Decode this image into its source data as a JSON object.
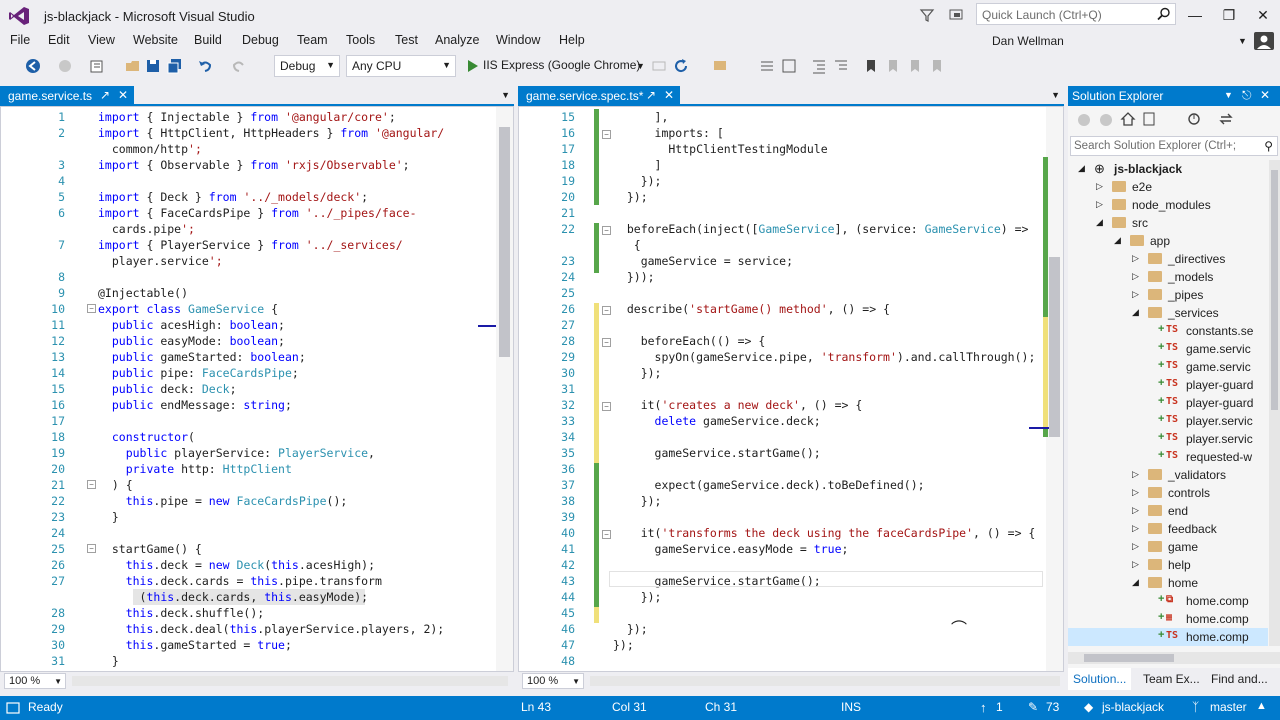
{
  "window": {
    "title": "js-blackjack - Microsoft Visual Studio",
    "quick_launch_placeholder": "Quick Launch (Ctrl+Q)"
  },
  "menu": [
    "File",
    "Edit",
    "View",
    "Website",
    "Build",
    "Debug",
    "Team",
    "Tools",
    "Test",
    "Analyze",
    "Window",
    "Help"
  ],
  "user": {
    "name": "Dan Wellman"
  },
  "toolbar": {
    "config": "Debug",
    "platform": "Any CPU",
    "run_target": "IIS Express (Google Chrome)"
  },
  "left_editor": {
    "tab": "game.service.ts",
    "zoom": "100 %",
    "lines": [
      {
        "n": "1",
        "code": "import { Injectable } from '@angular/core';"
      },
      {
        "n": "2",
        "code": "import { HttpClient, HttpHeaders } from '@angular/"
      },
      {
        "n": "",
        "code": "  common/http';"
      },
      {
        "n": "3",
        "code": "import { Observable } from 'rxjs/Observable';"
      },
      {
        "n": "4",
        "code": ""
      },
      {
        "n": "5",
        "code": "import { Deck } from '../_models/deck';"
      },
      {
        "n": "6",
        "code": "import { FaceCardsPipe } from '../_pipes/face-"
      },
      {
        "n": "",
        "code": "  cards.pipe';"
      },
      {
        "n": "7",
        "code": "import { PlayerService } from '../_services/"
      },
      {
        "n": "",
        "code": "  player.service';"
      },
      {
        "n": "8",
        "code": ""
      },
      {
        "n": "9",
        "code": "@Injectable()"
      },
      {
        "n": "10",
        "code": "export class GameService {"
      },
      {
        "n": "11",
        "code": "  public acesHigh: boolean;"
      },
      {
        "n": "12",
        "code": "  public easyMode: boolean;"
      },
      {
        "n": "13",
        "code": "  public gameStarted: boolean;"
      },
      {
        "n": "14",
        "code": "  public pipe: FaceCardsPipe;"
      },
      {
        "n": "15",
        "code": "  public deck: Deck;"
      },
      {
        "n": "16",
        "code": "  public endMessage: string;"
      },
      {
        "n": "17",
        "code": ""
      },
      {
        "n": "18",
        "code": "  constructor("
      },
      {
        "n": "19",
        "code": "    public playerService: PlayerService,"
      },
      {
        "n": "20",
        "code": "    private http: HttpClient"
      },
      {
        "n": "21",
        "code": "  ) {"
      },
      {
        "n": "22",
        "code": "    this.pipe = new FaceCardsPipe();"
      },
      {
        "n": "23",
        "code": "  }"
      },
      {
        "n": "24",
        "code": ""
      },
      {
        "n": "25",
        "code": "  startGame() {"
      },
      {
        "n": "26",
        "code": "    this.deck = new Deck(this.acesHigh);"
      },
      {
        "n": "27",
        "code": "    this.deck.cards = this.pipe.transform"
      },
      {
        "n": "",
        "code": "      (this.deck.cards, this.easyMode);"
      },
      {
        "n": "28",
        "code": "    this.deck.shuffle();"
      },
      {
        "n": "29",
        "code": "    this.deck.deal(this.playerService.players, 2);"
      },
      {
        "n": "30",
        "code": "    this.gameStarted = true;"
      },
      {
        "n": "31",
        "code": "  }"
      }
    ]
  },
  "right_editor": {
    "tab": "game.service.spec.ts*",
    "zoom": "100 %",
    "lines": [
      {
        "n": "15",
        "code": "      ],"
      },
      {
        "n": "16",
        "code": "      imports: ["
      },
      {
        "n": "17",
        "code": "        HttpClientTestingModule"
      },
      {
        "n": "18",
        "code": "      ]"
      },
      {
        "n": "19",
        "code": "    });"
      },
      {
        "n": "20",
        "code": "  });"
      },
      {
        "n": "21",
        "code": ""
      },
      {
        "n": "22",
        "code": "  beforeEach(inject([GameService], (service: GameService) =>"
      },
      {
        "n": "",
        "code": "   {"
      },
      {
        "n": "23",
        "code": "    gameService = service;"
      },
      {
        "n": "24",
        "code": "  }));"
      },
      {
        "n": "25",
        "code": ""
      },
      {
        "n": "26",
        "code": "  describe('startGame() method', () => {"
      },
      {
        "n": "27",
        "code": ""
      },
      {
        "n": "28",
        "code": "    beforeEach(() => {"
      },
      {
        "n": "29",
        "code": "      spyOn(gameService.pipe, 'transform').and.callThrough();"
      },
      {
        "n": "30",
        "code": "    });"
      },
      {
        "n": "31",
        "code": ""
      },
      {
        "n": "32",
        "code": "    it('creates a new deck', () => {"
      },
      {
        "n": "33",
        "code": "      delete gameService.deck;"
      },
      {
        "n": "34",
        "code": ""
      },
      {
        "n": "35",
        "code": "      gameService.startGame();"
      },
      {
        "n": "36",
        "code": ""
      },
      {
        "n": "37",
        "code": "      expect(gameService.deck).toBeDefined();"
      },
      {
        "n": "38",
        "code": "    });"
      },
      {
        "n": "39",
        "code": ""
      },
      {
        "n": "40",
        "code": "    it('transforms the deck using the faceCardsPipe', () => {"
      },
      {
        "n": "41",
        "code": "      gameService.easyMode = true;"
      },
      {
        "n": "42",
        "code": ""
      },
      {
        "n": "43",
        "code": "      gameService.startGame();"
      },
      {
        "n": "44",
        "code": "    });"
      },
      {
        "n": "45",
        "code": ""
      },
      {
        "n": "46",
        "code": "  });"
      },
      {
        "n": "47",
        "code": "});"
      },
      {
        "n": "48",
        "code": ""
      }
    ]
  },
  "solution_explorer": {
    "title": "Solution Explorer",
    "search_placeholder": "Search Solution Explorer (Ctrl+;",
    "items": [
      {
        "label": "js-blackjack",
        "depth": 0,
        "type": "solution",
        "arrow": "open"
      },
      {
        "label": "e2e",
        "depth": 1,
        "type": "folder",
        "arrow": "closed"
      },
      {
        "label": "node_modules",
        "depth": 1,
        "type": "folder",
        "arrow": "closed"
      },
      {
        "label": "src",
        "depth": 1,
        "type": "folder",
        "arrow": "open"
      },
      {
        "label": "app",
        "depth": 2,
        "type": "folder",
        "arrow": "open"
      },
      {
        "label": "_directives",
        "depth": 3,
        "type": "folder",
        "arrow": "closed"
      },
      {
        "label": "_models",
        "depth": 3,
        "type": "folder",
        "arrow": "closed"
      },
      {
        "label": "_pipes",
        "depth": 3,
        "type": "folder",
        "arrow": "closed"
      },
      {
        "label": "_services",
        "depth": 3,
        "type": "folder",
        "arrow": "open"
      },
      {
        "label": "constants.se",
        "depth": 4,
        "type": "ts",
        "arrow": ""
      },
      {
        "label": "game.servic",
        "depth": 4,
        "type": "ts",
        "arrow": ""
      },
      {
        "label": "game.servic",
        "depth": 4,
        "type": "ts",
        "arrow": ""
      },
      {
        "label": "player-guard",
        "depth": 4,
        "type": "ts",
        "arrow": ""
      },
      {
        "label": "player-guard",
        "depth": 4,
        "type": "ts",
        "arrow": ""
      },
      {
        "label": "player.servic",
        "depth": 4,
        "type": "ts",
        "arrow": ""
      },
      {
        "label": "player.servic",
        "depth": 4,
        "type": "ts",
        "arrow": ""
      },
      {
        "label": "requested-w",
        "depth": 4,
        "type": "ts",
        "arrow": ""
      },
      {
        "label": "_validators",
        "depth": 3,
        "type": "folder",
        "arrow": "closed"
      },
      {
        "label": "controls",
        "depth": 3,
        "type": "folder",
        "arrow": "closed"
      },
      {
        "label": "end",
        "depth": 3,
        "type": "folder",
        "arrow": "closed"
      },
      {
        "label": "feedback",
        "depth": 3,
        "type": "folder",
        "arrow": "closed"
      },
      {
        "label": "game",
        "depth": 3,
        "type": "folder",
        "arrow": "closed"
      },
      {
        "label": "help",
        "depth": 3,
        "type": "folder",
        "arrow": "closed"
      },
      {
        "label": "home",
        "depth": 3,
        "type": "folder",
        "arrow": "open"
      },
      {
        "label": "home.comp",
        "depth": 4,
        "type": "html",
        "arrow": ""
      },
      {
        "label": "home.comp",
        "depth": 4,
        "type": "css",
        "arrow": ""
      },
      {
        "label": "home.comp",
        "depth": 4,
        "type": "ts",
        "arrow": ""
      }
    ],
    "tabs": [
      "Solution...",
      "Team Ex...",
      "Find and..."
    ]
  },
  "status": {
    "ready": "Ready",
    "ln": "Ln 43",
    "col": "Col 31",
    "ch": "Ch 31",
    "ins": "INS",
    "up_count": "1",
    "edit_count": "73",
    "repo": "js-blackjack",
    "branch": "master"
  }
}
